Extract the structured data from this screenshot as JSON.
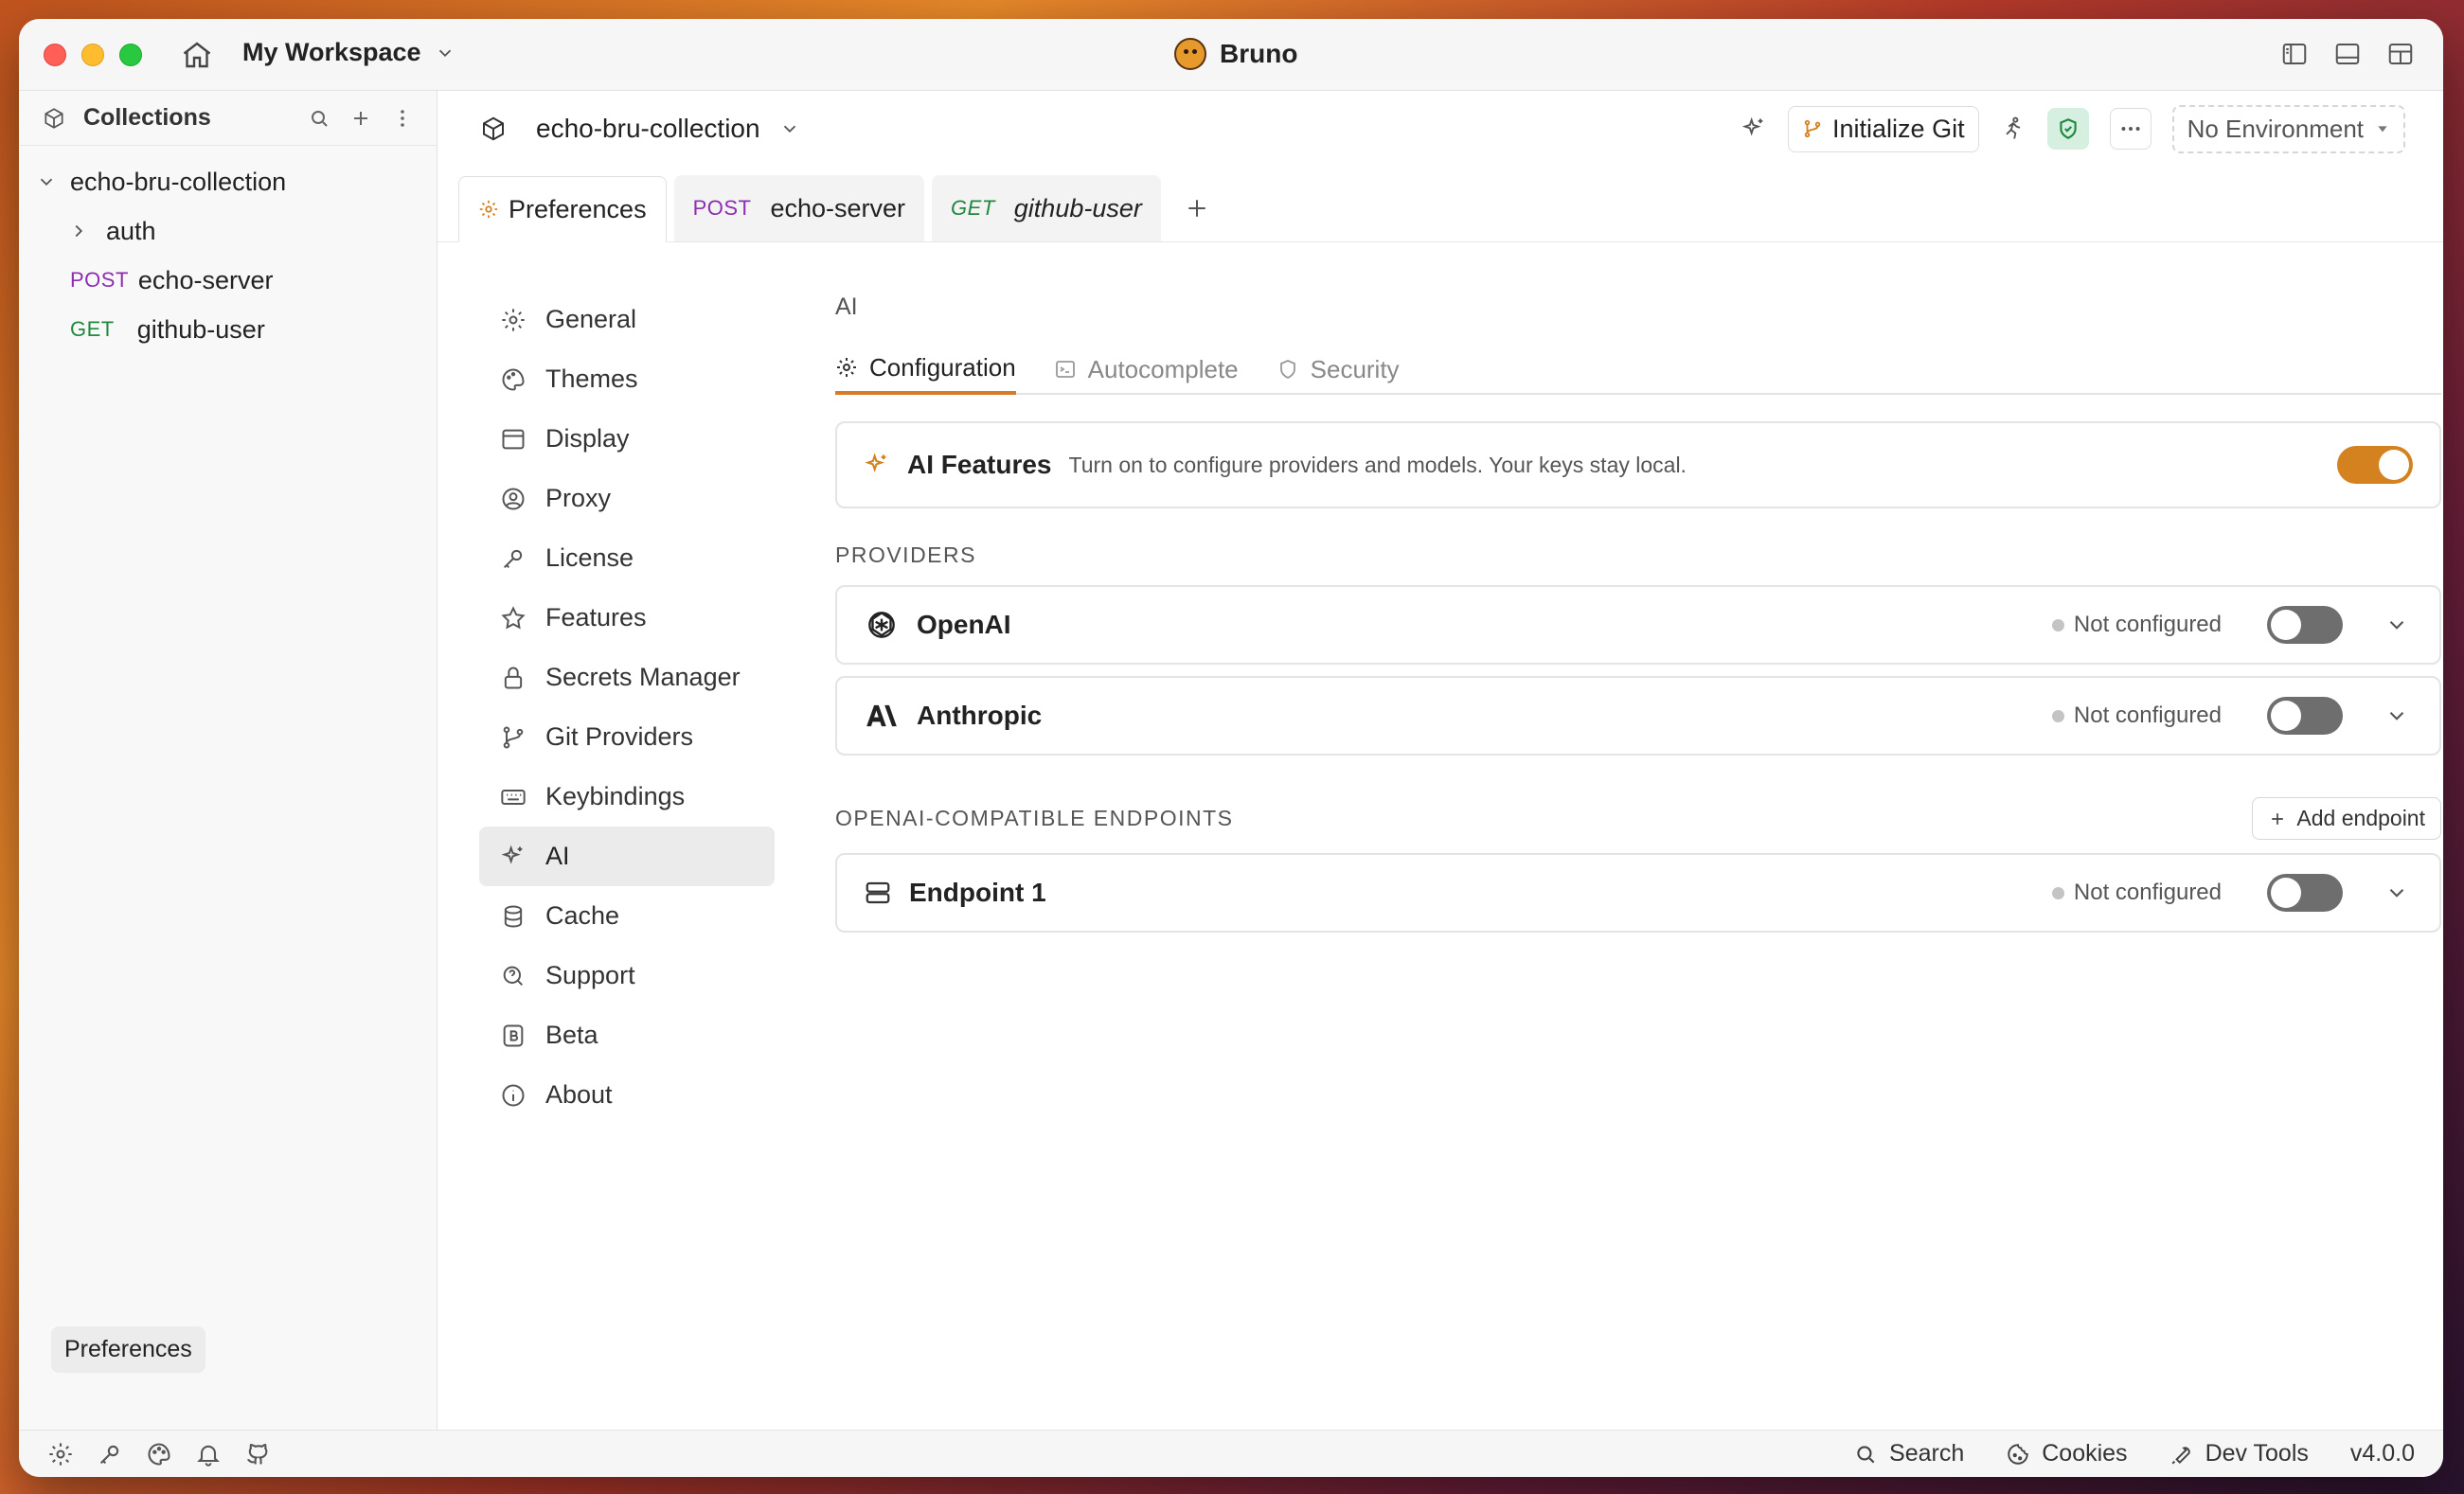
{
  "window": {
    "workspace": "My Workspace",
    "app_title": "Bruno"
  },
  "sidebar": {
    "title": "Collections",
    "collection": "echo-bru-collection",
    "items": [
      {
        "type": "folder",
        "label": "auth"
      },
      {
        "type": "request",
        "method": "POST",
        "label": "echo-server"
      },
      {
        "type": "request",
        "method": "GET",
        "label": "github-user"
      }
    ],
    "footer_tag": "Preferences"
  },
  "main_header": {
    "collection_name": "echo-bru-collection",
    "init_git_label": "Initialize Git",
    "environment": "No Environment"
  },
  "tabs": [
    {
      "method": "",
      "label": "Preferences",
      "active": true
    },
    {
      "method": "POST",
      "label": "echo-server"
    },
    {
      "method": "GET",
      "label": "github-user"
    }
  ],
  "settings_nav": [
    {
      "label": "General",
      "icon": "gear-icon"
    },
    {
      "label": "Themes",
      "icon": "palette-icon"
    },
    {
      "label": "Display",
      "icon": "display-icon"
    },
    {
      "label": "Proxy",
      "icon": "proxy-icon"
    },
    {
      "label": "License",
      "icon": "key-icon"
    },
    {
      "label": "Features",
      "icon": "star-icon"
    },
    {
      "label": "Secrets Manager",
      "icon": "lock-icon"
    },
    {
      "label": "Git Providers",
      "icon": "git-branch-icon"
    },
    {
      "label": "Keybindings",
      "icon": "keyboard-icon"
    },
    {
      "label": "AI",
      "icon": "sparkle-icon",
      "active": true
    },
    {
      "label": "Cache",
      "icon": "database-icon"
    },
    {
      "label": "Support",
      "icon": "support-icon"
    },
    {
      "label": "Beta",
      "icon": "beta-icon"
    },
    {
      "label": "About",
      "icon": "info-icon"
    }
  ],
  "ai_panel": {
    "section_title": "AI",
    "subtabs": [
      "Configuration",
      "Autocomplete",
      "Security"
    ],
    "feature_title": "AI Features",
    "feature_desc": "Turn on to configure providers and models. Your keys stay local.",
    "feature_enabled": true,
    "providers_label": "PROVIDERS",
    "providers": [
      {
        "name": "OpenAI",
        "status": "Not configured",
        "enabled": false
      },
      {
        "name": "Anthropic",
        "status": "Not configured",
        "enabled": false
      }
    ],
    "endpoints_label": "OPENAI-COMPATIBLE ENDPOINTS",
    "add_endpoint_label": "Add endpoint",
    "endpoints": [
      {
        "name": "Endpoint 1",
        "status": "Not configured",
        "enabled": false
      }
    ]
  },
  "statusbar": {
    "search": "Search",
    "cookies": "Cookies",
    "dev_tools": "Dev Tools",
    "version": "v4.0.0"
  },
  "colors": {
    "accent": "#d4811f",
    "post": "#8e2db0",
    "get": "#1f8a3e"
  }
}
